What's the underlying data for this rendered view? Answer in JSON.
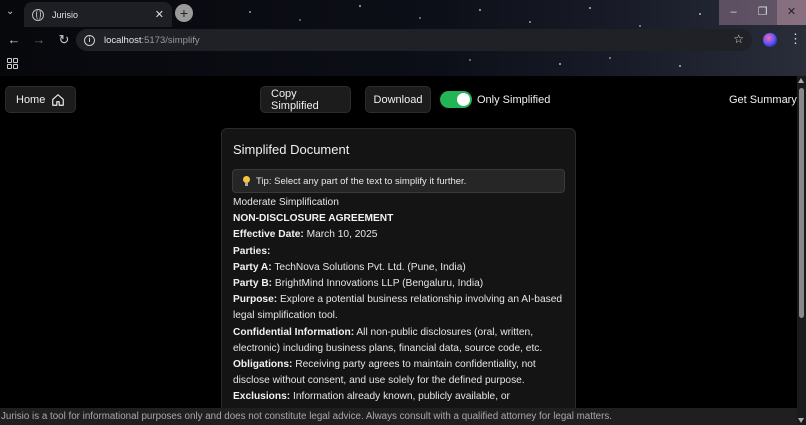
{
  "browser": {
    "tab_title": "Jurisio",
    "new_tab": "+",
    "url_host": "localhost",
    "url_path": ":5173/simplify"
  },
  "header": {
    "home_label": "Home",
    "copy_label": "Copy Simplified",
    "download_label": "Download",
    "toggle_label": "Only Simplified",
    "toggle_on": true,
    "summary_label": "Get Summary",
    "toggle_color": "#22b455"
  },
  "document": {
    "title": "Simplifed Document",
    "tip": "Tip: Select any part of the text to simplify it further.",
    "level": "Moderate Simplification",
    "heading": "NON-DISCLOSURE AGREEMENT",
    "effective_label": "Effective Date:",
    "effective_value": "March 10, 2025",
    "parties_label": "Parties:",
    "party_a_label": "Party A:",
    "party_a_value": "TechNova Solutions Pvt. Ltd. (Pune, India)",
    "party_b_label": "Party B:",
    "party_b_value": "BrightMind Innovations LLP (Bengaluru, India)",
    "purpose_label": "Purpose:",
    "purpose_value": "Explore a potential business relationship involving an AI-based legal simplification tool.",
    "confidential_label": "Confidential Information:",
    "confidential_value": "All non-public disclosures (oral, written, electronic) including business plans, financial data, source code, etc.",
    "obligations_label": "Obligations:",
    "obligations_value": "Receiving party agrees to maintain confidentiality, not disclose without consent, and use solely for the defined purpose.",
    "exclusions_label": "Exclusions:",
    "exclusions_value": "Information already known, publicly available, or"
  },
  "footer": {
    "disclaimer": "Jurisio is a tool for informational purposes only and does not constitute legal advice. Always consult with a qualified attorney for legal matters."
  }
}
